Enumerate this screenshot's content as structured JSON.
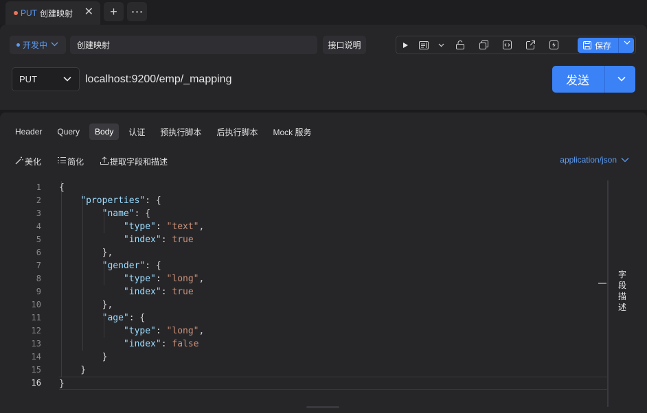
{
  "tab": {
    "method": "PUT",
    "title": "创建映射",
    "close": "✕"
  },
  "tabbar": {
    "add": "+",
    "more": "⋯"
  },
  "request": {
    "env_label": "开发中",
    "name_value": "创建映射",
    "doc_button": "接口说明",
    "save_label": "保存",
    "method": "PUT",
    "url": "localhost:9200/emp/_mapping",
    "send_label": "发送"
  },
  "subtabs": [
    "Header",
    "Query",
    "Body",
    "认证",
    "预执行脚本",
    "后执行脚本",
    "Mock 服务"
  ],
  "body_tools": {
    "beautify": "美化",
    "simplify": "简化",
    "extract": "提取字段和描述",
    "content_type": "application/json"
  },
  "editor": {
    "line_numbers": [
      "1",
      "2",
      "3",
      "4",
      "5",
      "6",
      "7",
      "8",
      "9",
      "10",
      "11",
      "12",
      "13",
      "14",
      "15",
      "16"
    ],
    "current_line": 16
  },
  "side_panel": {
    "label": "字段描述"
  },
  "colors": {
    "accent": "#3b82f6",
    "tab_dot": "#e8765c",
    "json_key": "#9cdcfe",
    "json_string": "#ce9178"
  }
}
